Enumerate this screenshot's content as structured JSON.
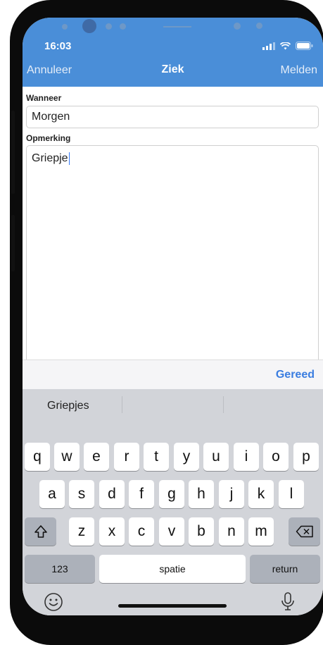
{
  "status_bar": {
    "time": "16:03"
  },
  "navbar": {
    "cancel": "Annuleer",
    "title": "Ziek",
    "submit": "Melden"
  },
  "form": {
    "when_label": "Wanneer",
    "when_value": "Morgen",
    "remark_label": "Opmerking",
    "remark_value": "Griepje"
  },
  "toolbar": {
    "done": "Gereed"
  },
  "keyboard": {
    "suggestions": [
      "Griepjes",
      "",
      ""
    ],
    "row1": [
      "q",
      "w",
      "e",
      "r",
      "t",
      "y",
      "u",
      "i",
      "o",
      "p"
    ],
    "row2": [
      "a",
      "s",
      "d",
      "f",
      "g",
      "h",
      "j",
      "k",
      "l"
    ],
    "row3": [
      "z",
      "x",
      "c",
      "v",
      "b",
      "n",
      "m"
    ],
    "numbers_key": "123",
    "space_key": "spatie",
    "return_key": "return"
  },
  "colors": {
    "accent": "#4a8ed8",
    "link": "#3a7de0",
    "keyboard_bg": "#d2d4d9"
  }
}
